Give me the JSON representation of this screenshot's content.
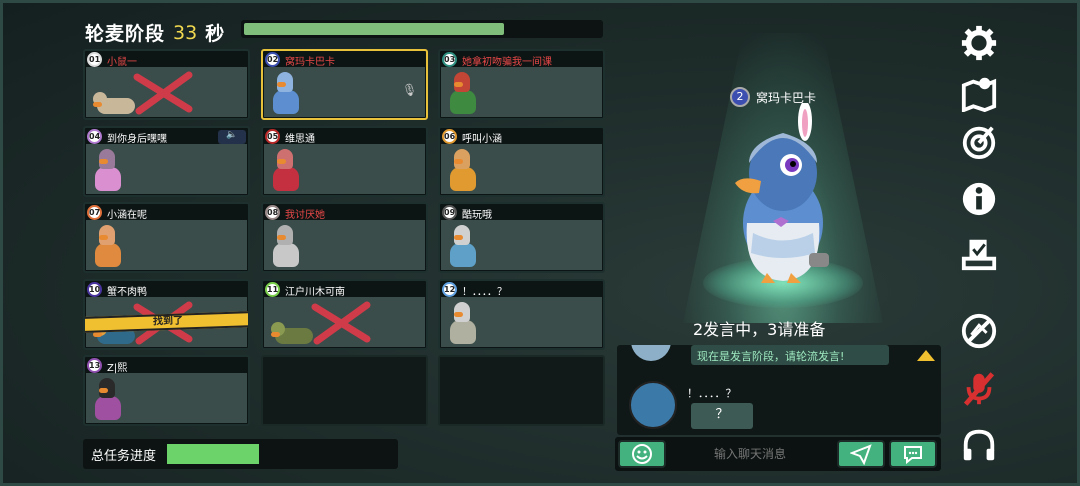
{
  "header": {
    "phase_label": "轮麦阶段",
    "seconds": "33",
    "unit": "秒",
    "timer_fraction": 0.73
  },
  "players": [
    {
      "num": "01",
      "name": "小鼠一",
      "name_color": "red",
      "state": "dead",
      "body": "#c9b79a",
      "head": "#c9b79a",
      "badge": "#ddd"
    },
    {
      "num": "02",
      "name": "窝玛卡巴卡",
      "name_color": "red",
      "state": "speaking",
      "body": "#5d8fd0",
      "head": "#8fb3df",
      "badge": "#3c4fb0"
    },
    {
      "num": "03",
      "name": "她拿初吻骗我一间课",
      "name_color": "red",
      "state": "alive",
      "body": "#3d8a40",
      "head": "#c24535",
      "badge": "#2e8f80"
    },
    {
      "num": "04",
      "name": "到你身后嘿嘿",
      "name_color": "white",
      "state": "alive",
      "body": "#d98fd0",
      "head": "#9a7a9a",
      "badge": "#b07ad0",
      "speaker": true
    },
    {
      "num": "05",
      "name": "维思通",
      "name_color": "white",
      "state": "alive",
      "body": "#c43040",
      "head": "#cf7070",
      "badge": "#b82828"
    },
    {
      "num": "06",
      "name": "呼叫小涵",
      "name_color": "white",
      "state": "alive",
      "body": "#e09a30",
      "head": "#d9a060",
      "badge": "#e09a30"
    },
    {
      "num": "07",
      "name": "小涵在呢",
      "name_color": "white",
      "state": "alive",
      "body": "#e08a40",
      "head": "#e0a070",
      "badge": "#e0703a"
    },
    {
      "num": "08",
      "name": "我讨厌她",
      "name_color": "red",
      "state": "alive",
      "body": "#c8c8c8",
      "head": "#b0b0b0",
      "badge": "#9a8a8a"
    },
    {
      "num": "09",
      "name": "酷玩哦",
      "name_color": "white",
      "state": "alive",
      "body": "#5fa0c8",
      "head": "#d0d0d0",
      "badge": "#555"
    },
    {
      "num": "10",
      "name": "蟹不肉鸭",
      "name_color": "white",
      "state": "found",
      "body": "#2f6a8a",
      "head": "#e0a040",
      "badge": "#4a35a0",
      "tape": "找到了"
    },
    {
      "num": "11",
      "name": "江户川木可南",
      "name_color": "white",
      "state": "dead",
      "body": "#6a7a40",
      "head": "#8a9a50",
      "badge": "#7ad04a"
    },
    {
      "num": "12",
      "name": "！．．．．？",
      "name_color": "white",
      "state": "alive",
      "body": "#b0b0a0",
      "head": "#d0d0d0",
      "badge": "#60a0e0"
    },
    {
      "num": "13",
      "name": "Z|熙",
      "name_color": "white",
      "state": "alive",
      "body": "#a050a0",
      "head": "#2a2a2a",
      "badge": "#9050b0"
    }
  ],
  "task": {
    "label": "总任务进度",
    "progress": 0.3
  },
  "hero": {
    "num": "2",
    "name": "窝玛卡巴卡"
  },
  "status": "2发言中，3请准备",
  "chat": {
    "system": "现在是发言阶段，请轮流发言!",
    "sender": "！．．．．？",
    "message": "？",
    "placeholder": "输入聊天消息"
  },
  "sidebar": [
    "gear-icon",
    "map-icon",
    "target-icon",
    "info-icon",
    "vote-icon",
    "no-report-icon",
    "mic-off-icon",
    "headphones-icon"
  ]
}
